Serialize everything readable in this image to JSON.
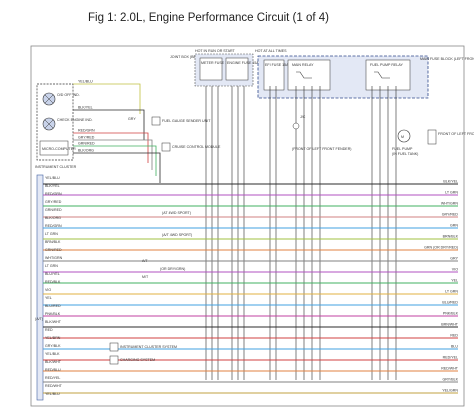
{
  "header": {
    "title": "Fig 1: 2.0L, Engine Performance Circuit (1 of 4)"
  },
  "colors": {
    "border": "#888888",
    "wire_default": "#2b2b2b",
    "module_fill": "#e3e8f5",
    "module_stroke": "#4060a0"
  },
  "left_boxes": {
    "cluster_label": "INSTRUMENT CLUSTER",
    "cd_od_label": "O/D OFF IND.",
    "check_engine_label": "CHECK ENGINE IND.",
    "computer_label": "MICRO-COMPUTER",
    "pcm_label": "(A/T)"
  },
  "fuse_boxes": {
    "hot_label": "HOT IN RUN OR START",
    "hot_all_times": "HOT AT ALL TIMES",
    "junction_label": "JOINT BOX (BEHIND LEFT KICK PANEL)",
    "meter_fuse": "METER FUSE 15A",
    "engine_fuse": "ENGINE FUSE 15A",
    "efi_fuse": "EFI FUSE 15A",
    "main_relay": "MAIN RELAY",
    "fuel_pump_relay": "FUEL PUMP RELAY",
    "main_block": "MAIN FUSE BLOCK (LEFT FRONT OF ENGINE COMPARTMENT)",
    "side_note": "FRONT OF LEFT FRONT FENDER PANEL"
  },
  "components": {
    "fuel_gauge": "FUEL GAUGE SENDER UNIT",
    "cruise": "CRUISE CONTROL MODULE",
    "jc_label": "J/C",
    "fuel_pump": "FUEL PUMP",
    "fuel_tank": "(IN FUEL TANK)",
    "front_left_fender": "(FRONT OF LEFT FRONT FENDER)",
    "ecu_label": "E/U",
    "transmission_note": "(AT 4WD SPORT)",
    "transmission_note2": "(A/T 4WD SPORT)",
    "dr_label": "(OR DRY/GRN)",
    "instrument_system": "INSTRUMENT CLUSTER SYSTEM",
    "charging_system": "CHARGING SYSTEM",
    "at_label": "A/T",
    "mt_label": "M/T"
  },
  "wire_labels_left": [
    "YEL/BLU",
    "BLK/YEL",
    "RED/GRN",
    "GRY/RED",
    "GRN/RED",
    "BLK/ORG",
    "RED/GRN",
    "LT GRN",
    "BRN/BLK",
    "GRN/RED",
    "WHT/GRN",
    "LT GRN",
    "BLU/YEL",
    "RED/BLK",
    "VIO",
    "YEL",
    "BLU/RED",
    "PNK/BLK",
    "BLK/WHT",
    "RED",
    "YEL/BRN",
    "GRY/BLK",
    "YEL/BLK",
    "BLK/WHT",
    "RED/BLU",
    "RED/YEL",
    "RED/WHT",
    "YEL/BLU"
  ],
  "wire_labels_right": [
    "BLK/YEL",
    "LT GRN",
    "WHT/GRN",
    "GRY/RED",
    "GRN",
    "BRN/BLK",
    "GRN (OR DRY/RED)",
    "GRY",
    "VIO",
    "YEL",
    "LT GRN",
    "BLU/RED",
    "PNK/BLK",
    "BRN/WHT",
    "RED",
    "BLU",
    "RED/YEL",
    "RED/WHT",
    "GRY/BLK",
    "YEL/GRN"
  ]
}
